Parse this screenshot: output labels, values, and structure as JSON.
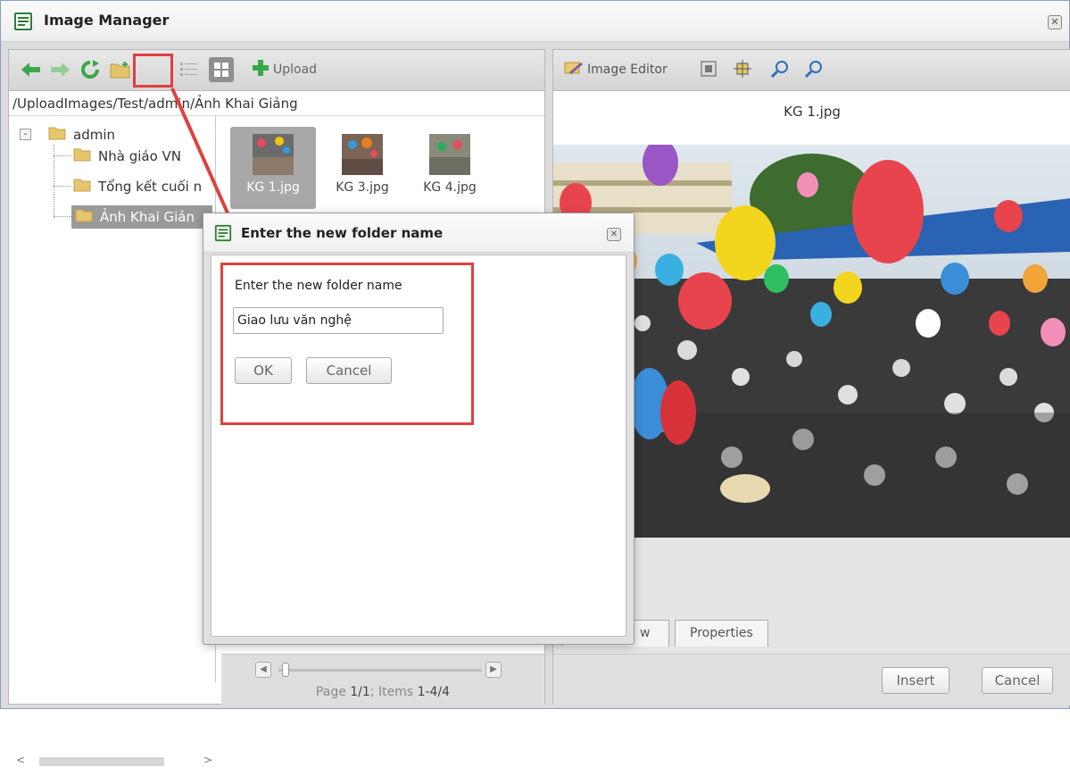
{
  "window": {
    "title": "Image Manager",
    "close_glyph": "✕"
  },
  "left_toolbar": {
    "upload_label": "Upload",
    "icons": [
      "back-arrow-icon",
      "forward-arrow-icon",
      "refresh-icon",
      "new-folder-icon",
      "list-view-icon",
      "thumbnail-view-icon",
      "upload-plus-icon"
    ]
  },
  "path": "/UploadImages/Test/admin/Ảnh Khai Giảng",
  "tree": {
    "root": "admin",
    "expander": "-",
    "children": [
      "Nhà giáo VN",
      "Tổng kết cuối n",
      "Ảnh Khai Giản"
    ]
  },
  "files": [
    {
      "name": "KG 1.jpg",
      "selected": true
    },
    {
      "name": "KG 3.jpg",
      "selected": false
    },
    {
      "name": "KG 4.jpg",
      "selected": false
    }
  ],
  "pager": {
    "prefix": "Page ",
    "page": "1/1",
    "middle": "; Items ",
    "items": "1-4/4"
  },
  "right_toolbar": {
    "image_editor_label": "Image Editor"
  },
  "preview": {
    "filename": "KG 1.jpg"
  },
  "tabs": [
    "Preview",
    "Properties"
  ],
  "tab_partial": "w",
  "footer": {
    "insert_label": "Insert",
    "cancel_label": "Cancel"
  },
  "dialog": {
    "title": "Enter the new folder name",
    "prompt": "Enter the new folder name",
    "value": "Giao lưu văn nghệ",
    "ok_label": "OK",
    "cancel_label": "Cancel",
    "close_glyph": "✕"
  },
  "colors": {
    "highlight": "#e04040",
    "accent_green": "#3aa84a",
    "accent_blue": "#2e6fb8"
  }
}
